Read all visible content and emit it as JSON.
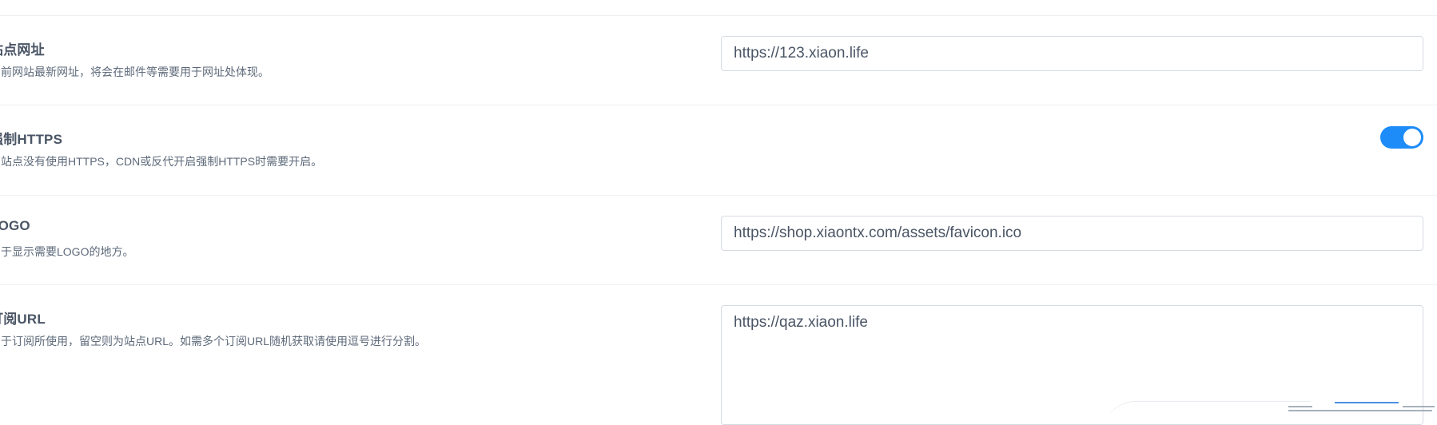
{
  "settings": {
    "site_url": {
      "title": "站点网址",
      "description": "当前网站最新网址，将会在邮件等需要用于网址处体现。",
      "value": "https://123.xiaon.life"
    },
    "force_https": {
      "title": "强制HTTPS",
      "description": "当站点没有使用HTTPS，CDN或反代开启强制HTTPS时需要开启。",
      "enabled": true
    },
    "logo": {
      "title": "LOGO",
      "description": "用于显示需要LOGO的地方。",
      "value": "https://shop.xiaontx.com/assets/favicon.ico"
    },
    "subscribe_url": {
      "title": "订阅URL",
      "description": "用于订阅所使用，留空则为站点URL。如需多个订阅URL随机获取请使用逗号进行分割。",
      "value": "https://qaz.xiaon.life"
    }
  },
  "colors": {
    "accent": "#1d8cf8",
    "border": "#d6dbe3",
    "divider": "#eef0f3",
    "title": "#4a5565",
    "description": "#5e6a7a"
  }
}
